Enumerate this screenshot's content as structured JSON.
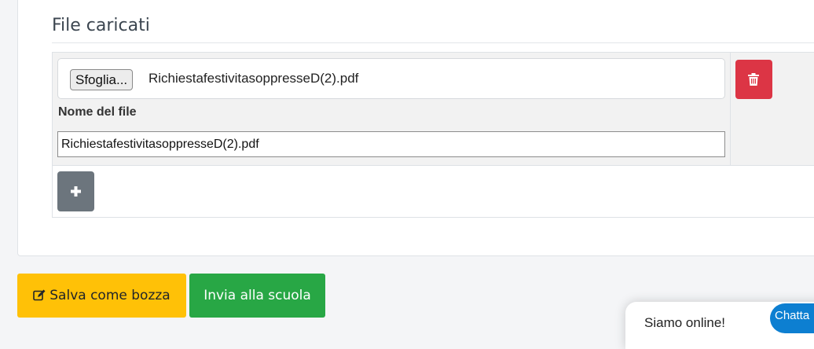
{
  "files_section": {
    "title": "File caricati",
    "rows": [
      {
        "browse_label": "Sfoglia...",
        "chosen_file": "RichiestafestivitasoppresseD(2).pdf",
        "name_label": "Nome del file",
        "name_value": "RichiestafestivitasoppresseD(2).pdf"
      }
    ],
    "delete_icon": "trash-icon",
    "add_icon": "plus-icon"
  },
  "actions": {
    "draft_label": "Salva come bozza",
    "draft_icon": "edit-icon",
    "send_label": "Invia alla scuola"
  },
  "chat": {
    "status": "Siamo online!",
    "button_label": "Chatta"
  },
  "colors": {
    "danger": "#dc3545",
    "secondary": "#6c757d",
    "warning": "#ffc107",
    "success": "#28a745",
    "chat": "#0d7fd1"
  }
}
